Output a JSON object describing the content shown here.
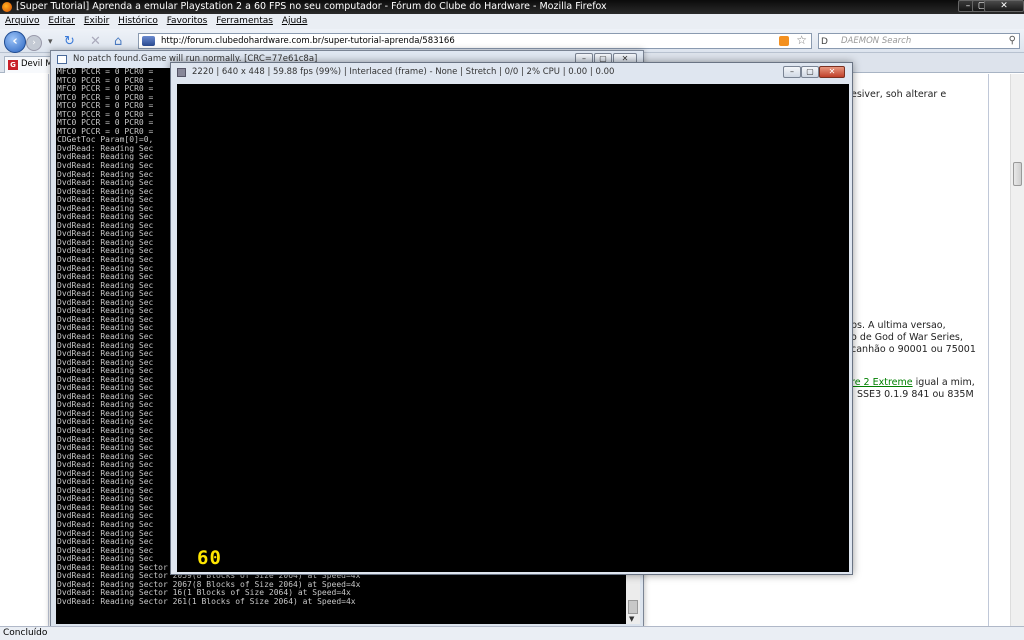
{
  "browser": {
    "title": "[Super Tutorial] Aprenda a emular Playstation 2 a 60 FPS no seu computador - Fórum do Clube do Hardware - Mozilla Firefox",
    "menu": [
      "Arquivo",
      "Editar",
      "Exibir",
      "Histórico",
      "Favoritos",
      "Ferramentas",
      "Ajuda"
    ],
    "url": "http://forum.clubedohardware.com.br/super-tutorial-aprenda/583166",
    "search_placeholder": "DAEMON Search",
    "search_engine": "D",
    "tab_label": "Devil M",
    "status": "Concluído",
    "controls": {
      "minimize": "–",
      "maximize": "▢",
      "close": "✕"
    }
  },
  "page": {
    "line1": "esiver, soh alterar e",
    "para": [
      "ps. A ultima versao,",
      "o de God of War Series,",
      "canhão o 90001 ou 75001"
    ],
    "link": "re 2 Extreme",
    "after_link": " igual a mim,",
    "line_last": "SSE3 0.1.9 841 ou 835M"
  },
  "console": {
    "title": "No patch found.Game will run normally. [CRC=77e61c8a]",
    "header_lines": [
      "MFC0 PCCR = 0 PCR0 = ",
      "MTC0 PCCR = 0 PCR0 = ",
      "MFC0 PCCR = 0 PCR0 = ",
      "MTC0 PCCR = 0 PCR0 = ",
      "MTC0 PCCR = 0 PCR0 = ",
      "MTC0 PCCR = 0 PCR0 = ",
      "MTC0 PCCR = 0 PCR0 = ",
      "MTC0 PCCR = 0 PCR0 = ",
      "CDGetToc Param[0]=0,"
    ],
    "reading_line": "DvdRead: Reading Sec",
    "reading_count": 49,
    "tail_lines": [
      "DvdRead: Reading Sector 2052(1 Blocks of Size 2064) at Speed=4x",
      "DvdRead: Reading Sector 2059(8 Blocks of Size 2064) at Speed=4x",
      "DvdRead: Reading Sector 2067(8 Blocks of Size 2064) at Speed=4x",
      "DvdRead: Reading Sector 16(1 Blocks of Size 2064) at Speed=4x",
      "DvdRead: Reading Sector 261(1 Blocks of Size 2064) at Speed=4x"
    ]
  },
  "emulator": {
    "title": "2220 | 640 x 448 | 59.88 fps (99%) | Interlaced (frame) - None | Stretch | 0/0 | 2% CPU | 0.00 | 0.00",
    "fps_overlay": "60"
  },
  "colors": {
    "fps": "#ffe600",
    "console_bg": "#000000",
    "link": "#008000"
  }
}
